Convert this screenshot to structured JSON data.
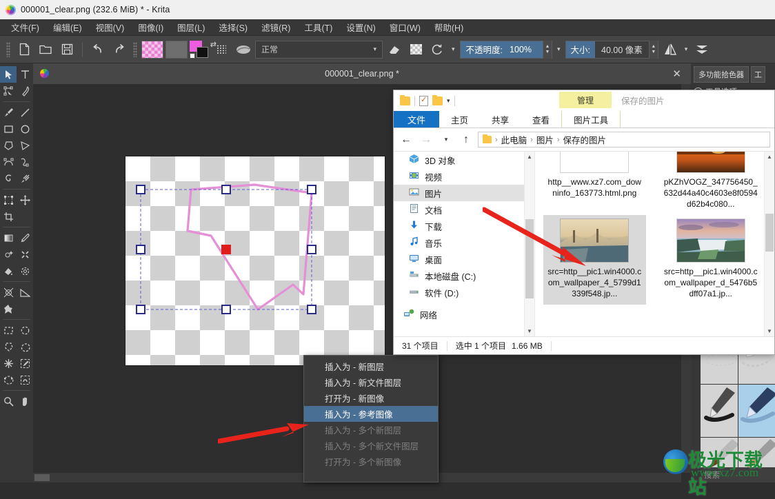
{
  "app": {
    "titlebar": {
      "text": "000001_clear.png (232.6 MiB)  * - Krita",
      "logo_icon": "krita-logo-icon"
    },
    "menubar": [
      {
        "label": "文件(F)"
      },
      {
        "label": "编辑(E)"
      },
      {
        "label": "视图(V)"
      },
      {
        "label": "图像(I)"
      },
      {
        "label": "图层(L)"
      },
      {
        "label": "选择(S)"
      },
      {
        "label": "滤镜(R)"
      },
      {
        "label": "工具(T)"
      },
      {
        "label": "设置(N)"
      },
      {
        "label": "窗口(W)"
      },
      {
        "label": "帮助(H)"
      }
    ],
    "toolbar": {
      "new_icon": "new-document-icon",
      "open_icon": "open-folder-icon",
      "save_icon": "save-icon",
      "undo_icon": "undo-icon",
      "redo_icon": "redo-icon",
      "pattern_icon": "pattern-swatch-icon",
      "gradient_icon": "gradient-swatch-icon",
      "fgbg_icon": "foreground-background-color-icon",
      "presets_icon": "preset-list-icon",
      "brush_icon": "brush-preset-icon",
      "blend_mode": "正常",
      "blend_caret": "▾",
      "eraser_icon": "eraser-icon",
      "alpha_icon": "alpha-lock-icon",
      "reload_icon": "reload-preset-icon",
      "opacity_label": "不透明度:",
      "opacity_value": "100%",
      "size_label": "大小:",
      "size_value": "40.00 像素",
      "mirror_h_icon": "mirror-horizontal-icon",
      "mirror_v_icon": "mirror-vertical-icon"
    },
    "toolbox": {
      "tools": [
        "select-shapes-tool",
        "text-tool",
        "edit-shapes-tool",
        "calligraphy-tool",
        "freehand-brush-tool",
        "line-tool",
        "rectangle-tool",
        "ellipse-tool",
        "polygon-tool",
        "polyline-tool",
        "bezier-curve-tool",
        "freehand-path-tool",
        "dynamic-brush-tool",
        "multibrush-tool",
        "transform-tool",
        "move-tool",
        "crop-tool",
        "gradient-tool",
        "color-sampler-tool",
        "colorize-mask-tool",
        "smart-patch-tool",
        "fill-tool",
        "enclose-and-fill-tool",
        "assistant-tool",
        "measure-tool",
        "reference-images-tool",
        "rectangular-selection-tool",
        "elliptical-selection-tool",
        "polygonal-selection-tool",
        "freehand-selection-tool",
        "contiguous-selection-tool",
        "similar-color-selection-tool",
        "bezier-selection-tool",
        "magnetic-selection-tool",
        "zoom-tool",
        "pan-tool"
      ],
      "active_tool": "select-shapes-tool"
    },
    "document_tab": {
      "title": "000001_clear.png *",
      "close_icon": "close-tab-icon",
      "doc_icon": "krita-doc-icon"
    },
    "right_dock": {
      "picker_button": "多功能拾色器",
      "tool_button": "工",
      "tool_options_label": "工具选项",
      "lock_icon": "lock-icon",
      "search_placeholder": "搜索",
      "presets": [
        "eraser-soft-preset",
        "eraser-hard-preset",
        "ink-pen-preset",
        "ink-tilt-preset",
        "wet-brush-preset",
        "dry-brush-preset"
      ],
      "selected_preset_index": 3
    },
    "context_menu": {
      "items": [
        {
          "label": "插入为 - 新图层",
          "state": "normal"
        },
        {
          "label": "插入为 - 新文件图层",
          "state": "normal"
        },
        {
          "label": "打开为 - 新图像",
          "state": "normal"
        },
        {
          "label": "插入为 - 参考图像",
          "state": "highlighted"
        },
        {
          "label": "插入为 - 多个新图层",
          "state": "disabled"
        },
        {
          "label": "插入为 - 多个新文件图层",
          "state": "disabled"
        },
        {
          "label": "打开为 - 多个新图像",
          "state": "disabled"
        }
      ]
    }
  },
  "explorer": {
    "quick_access": {
      "folder_icon": "folder-icon",
      "properties_icon": "properties-checkbox-icon",
      "new_folder_icon": "new-folder-icon",
      "customize_caret": "▾"
    },
    "contextual_tab_title": "管理",
    "window_title": "保存的图片",
    "ribbon_tabs": [
      {
        "label": "文件",
        "kind": "file"
      },
      {
        "label": "主页",
        "kind": "normal"
      },
      {
        "label": "共享",
        "kind": "normal"
      },
      {
        "label": "查看",
        "kind": "normal"
      },
      {
        "label": "图片工具",
        "kind": "contextual"
      }
    ],
    "nav": {
      "back_icon": "back-arrow-icon",
      "forward_icon": "forward-arrow-icon",
      "recent_caret": "▾",
      "up_icon": "up-arrow-icon",
      "address_folder_icon": "folder-icon",
      "breadcrumbs": [
        "此电脑",
        "图片",
        "保存的图片"
      ]
    },
    "sidebar": {
      "items": [
        {
          "label": "3D 对象",
          "icon": "3d-objects-icon",
          "selected": false
        },
        {
          "label": "视频",
          "icon": "videos-icon",
          "selected": false
        },
        {
          "label": "图片",
          "icon": "pictures-icon",
          "selected": true
        },
        {
          "label": "文档",
          "icon": "documents-icon",
          "selected": false
        },
        {
          "label": "下载",
          "icon": "downloads-icon",
          "selected": false
        },
        {
          "label": "音乐",
          "icon": "music-icon",
          "selected": false
        },
        {
          "label": "桌面",
          "icon": "desktop-icon",
          "selected": false
        },
        {
          "label": "本地磁盘 (C:)",
          "icon": "local-disk-icon",
          "selected": false
        },
        {
          "label": "软件 (D:)",
          "icon": "disk-icon",
          "selected": false
        },
        {
          "label": "网络",
          "icon": "network-icon",
          "selected": false
        }
      ]
    },
    "files": [
      {
        "name": "http__www.xz7.com_downinfo_163773.html.png",
        "thumb": "qrcode",
        "selected": false
      },
      {
        "name": "pKZhVOGZ_347756450_632d44a40c4603e8f0594d62b4c080...",
        "thumb": "sunset",
        "selected": false
      },
      {
        "name": "src=http__pic1.win4000.com_wallpaper_4_5799d1339f548.jp...",
        "thumb": "winter-river",
        "selected": true
      },
      {
        "name": "src=http__pic1.win4000.com_wallpaper_d_5476b5dff07a1.jp...",
        "thumb": "waterfall",
        "selected": false
      }
    ],
    "status": {
      "item_count": "31 个项目",
      "selection": "选中 1 个项目",
      "size": "1.66 MB"
    }
  },
  "watermark": {
    "title": "极光下载站",
    "url": "www.xz7.com",
    "logo_icon": "aurora-logo-icon"
  },
  "colors": {
    "krita_bg": "#373737",
    "krita_toolbar": "#454545",
    "accent_blue": "#4a6f94",
    "explorer_blue": "#1471c4",
    "contextual_yellow": "#f5f0a0",
    "arrow_red": "#e8231b",
    "selection_pink": "#e48fd6",
    "handle_blue": "#3a3aa0",
    "pivot_red": "#e21b1b"
  }
}
